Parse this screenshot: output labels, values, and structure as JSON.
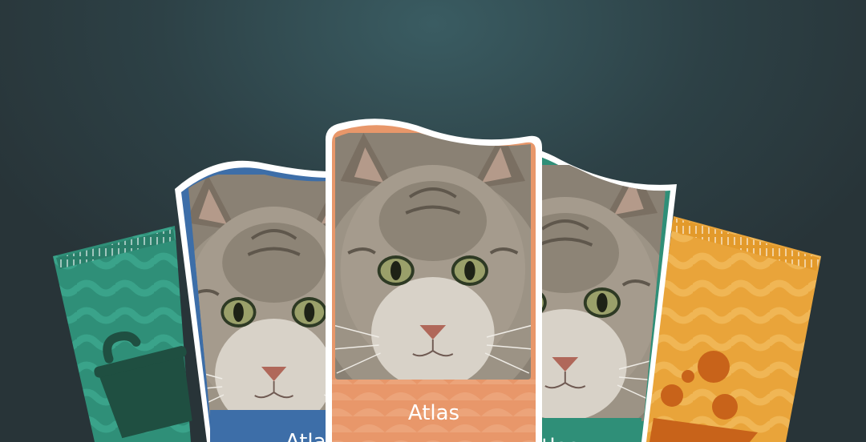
{
  "cards": [
    {
      "id": "pack-left",
      "kind": "food-pack",
      "color": "#2f8f78",
      "icon": "bowl-icon"
    },
    {
      "id": "card-blue",
      "kind": "cat-card",
      "name": "Atlas",
      "color": "#3d6ea8"
    },
    {
      "id": "card-green",
      "kind": "cat-card",
      "name": "Atlas",
      "color": "#2f8f78"
    },
    {
      "id": "pack-right",
      "kind": "food-pack",
      "color": "#e9a43a",
      "icon": "bowl-icon"
    },
    {
      "id": "card-front",
      "kind": "cat-card",
      "name": "Atlas",
      "color": "#e8976a"
    }
  ],
  "colors": {
    "frame": "#ffffff",
    "background": "#2d4146"
  }
}
